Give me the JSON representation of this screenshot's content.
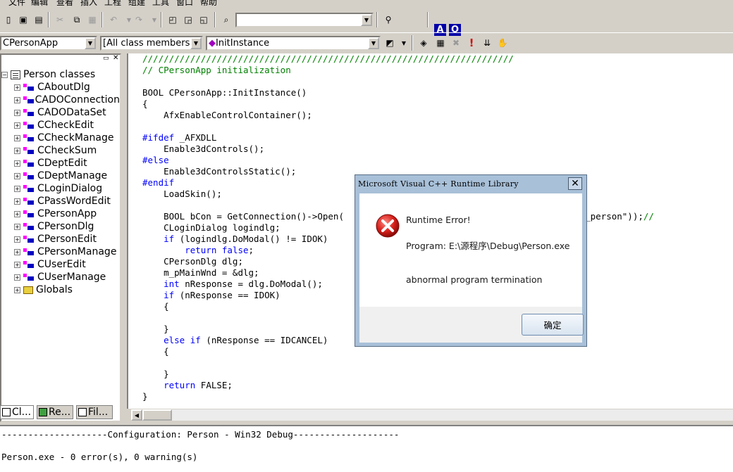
{
  "menu": [
    "文件",
    "编辑",
    "查看",
    "插入",
    "工程",
    "组建",
    "工具",
    "窗口",
    "帮助"
  ],
  "toolbar": {
    "find_combo_value": "",
    "ao_a": "A",
    "ao_o": "O"
  },
  "wizardbar": {
    "class_combo": "CPersonApp",
    "filter_combo": "[All class members]",
    "member_combo": "InitInstance"
  },
  "workspace": {
    "root_label": "Person classes",
    "classes": [
      "CAboutDlg",
      "CADOConnection",
      "CADODataSet",
      "CCheckEdit",
      "CCheckManage",
      "CCheckSum",
      "CDeptEdit",
      "CDeptManage",
      "CLoginDialog",
      "CPassWordEdit",
      "CPersonApp",
      "CPersonDlg",
      "CPersonEdit",
      "CPersonManage",
      "CUserEdit",
      "CUserManage"
    ],
    "globals_label": "Globals",
    "tabs": [
      "Cl...",
      "Re...",
      "Fil..."
    ]
  },
  "code": {
    "lines": [
      {
        "t": "cm",
        "s": "//////////////////////////////////////////////////////////////////////"
      },
      {
        "t": "cm",
        "s": "// CPersonApp initialization"
      },
      {
        "t": "n",
        "s": ""
      },
      {
        "t": "n",
        "s": "BOOL CPersonApp::InitInstance()"
      },
      {
        "t": "n",
        "s": "{"
      },
      {
        "t": "n",
        "s": "    AfxEnableControlContainer();"
      },
      {
        "t": "n",
        "s": ""
      },
      {
        "t": "kwpre",
        "k": "#ifdef",
        "s": " _AFXDLL"
      },
      {
        "t": "n",
        "s": "    Enable3dControls();"
      },
      {
        "t": "kwpre",
        "k": "#else",
        "s": ""
      },
      {
        "t": "n",
        "s": "    Enable3dControlsStatic();"
      },
      {
        "t": "kwpre",
        "k": "#endif",
        "s": ""
      },
      {
        "t": "n",
        "s": "    LoadSkin();"
      },
      {
        "t": "n",
        "s": ""
      },
      {
        "t": "open",
        "s": "    BOOL bCon = GetConnection()->Open(",
        "tail": ",\"tb_person\"));",
        "cm": "//"
      },
      {
        "t": "n",
        "s": "    CLoginDialog logindlg;"
      },
      {
        "t": "kwmid",
        "pre": "    ",
        "k": "if",
        "s": " (logindlg.DoModal() != IDOK)"
      },
      {
        "t": "kwmid",
        "pre": "        ",
        "k": "return false",
        "s": ";"
      },
      {
        "t": "n",
        "s": "    CPersonDlg dlg;"
      },
      {
        "t": "n",
        "s": "    m_pMainWnd = &dlg;"
      },
      {
        "t": "kwmid",
        "pre": "    ",
        "k": "int",
        "s": " nResponse = dlg.DoModal();"
      },
      {
        "t": "kwmid",
        "pre": "    ",
        "k": "if",
        "s": " (nResponse == IDOK)"
      },
      {
        "t": "n",
        "s": "    {"
      },
      {
        "t": "n",
        "s": ""
      },
      {
        "t": "n",
        "s": "    }"
      },
      {
        "t": "kwmid",
        "pre": "    ",
        "k": "else if",
        "s": " (nResponse == IDCANCEL)"
      },
      {
        "t": "n",
        "s": "    {"
      },
      {
        "t": "n",
        "s": ""
      },
      {
        "t": "n",
        "s": "    }"
      },
      {
        "t": "kwmid",
        "pre": "    ",
        "k": "return",
        "s": " FALSE;"
      },
      {
        "t": "n",
        "s": "}"
      }
    ]
  },
  "output": {
    "config_line": "--------------------Configuration: Person - Win32 Debug--------------------",
    "result_line": "Person.exe - 0 error(s), 0 warning(s)"
  },
  "dialog": {
    "title": "Microsoft Visual C++ Runtime Library",
    "heading": "Runtime Error!",
    "program_line": "Program: E:\\源程序\\Debug\\Person.exe",
    "message": "abnormal program termination",
    "ok_label": "确定",
    "close_glyph": "✕"
  },
  "colors": {
    "keyword": "#0000ff",
    "comment": "#008000",
    "dialog_frame": "#a8c0d8",
    "error_red": "#d8201c"
  }
}
